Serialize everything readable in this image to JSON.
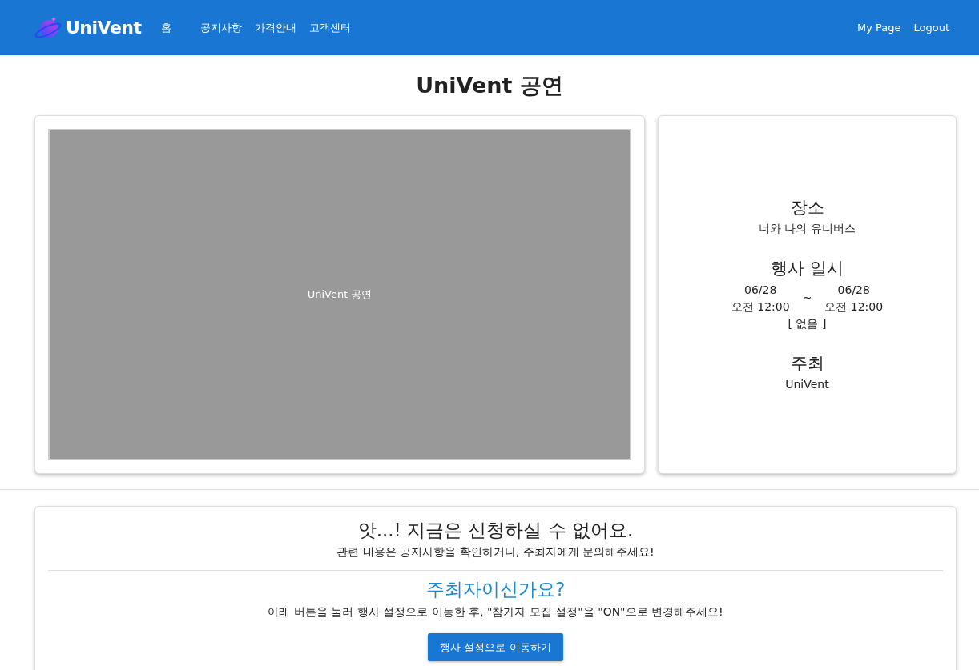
{
  "navbar": {
    "brand": "UniVent",
    "links": [
      {
        "label": "홈"
      },
      {
        "label": "공지사항"
      },
      {
        "label": "가격안내"
      },
      {
        "label": "고객센터"
      }
    ],
    "right_links": [
      {
        "label": "My Page"
      },
      {
        "label": "Logout"
      }
    ]
  },
  "title": "UniVent 공연",
  "poster": {
    "caption": "UniVent 공연"
  },
  "info": {
    "place_label": "장소",
    "place": "너와 나의 유니버스",
    "date_label": "행사 일시",
    "start_date": "06/28",
    "start_time": "오전 12:00",
    "separator": "~",
    "end_date": "06/28",
    "end_time": "오전 12:00",
    "note": "[ 없음 ]",
    "host_label": "주최",
    "host": "UniVent"
  },
  "notice": {
    "heading": "앗...! 지금은 신청하실 수 없어요.",
    "text": "관련 내용은 공지사항을 확인하거나, 주최자에게 문의해주세요!",
    "host_heading": "주최자이신가요?",
    "host_text": "아래 버튼을 눌러 행사 설정으로 이동한 후, \"참가자 모집 설정\"을 \"ON\"으로 변경해주세요!",
    "button": "행사 설정으로 이동하기"
  }
}
